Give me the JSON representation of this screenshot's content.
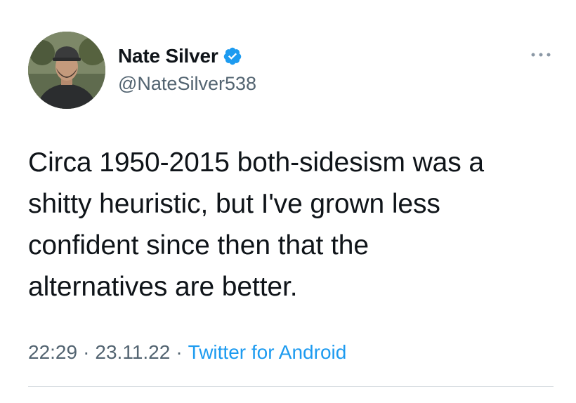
{
  "author": {
    "display_name": "Nate Silver",
    "handle": "@NateSilver538",
    "verified": true,
    "avatar_icon": "profile-photo"
  },
  "tweet": {
    "text": "Circa 1950-2015 both-sidesism was a\nshitty heuristic, but I've grown less\nconfident since then that the\nalternatives are better."
  },
  "meta": {
    "time": "22:29",
    "separator": "·",
    "date": "23.11.22",
    "source": "Twitter for Android"
  },
  "menu": {
    "icon": "more-dots-icon"
  },
  "colors": {
    "text_primary": "#0f1419",
    "text_secondary": "#536471",
    "accent": "#1d9bf0",
    "divider": "#dbe0e4"
  }
}
